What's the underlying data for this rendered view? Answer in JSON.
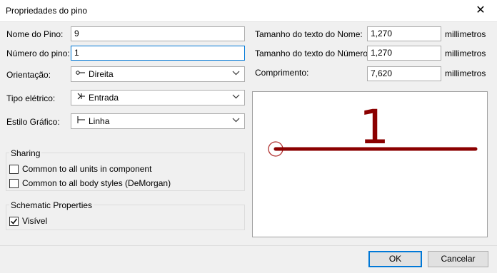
{
  "window": {
    "title": "Propriedades do pino",
    "close_glyph": "✕"
  },
  "left": {
    "pin_name": {
      "label": "Nome do Pino:",
      "value": "9"
    },
    "pin_number": {
      "label": "Número do pino:",
      "value": "1"
    },
    "orientation": {
      "label": "Orientação:",
      "value": "Direita",
      "icon": "pin-right-icon"
    },
    "electrical_type": {
      "label": "Tipo elétrico:",
      "value": "Entrada",
      "icon": "input-arrow-icon"
    },
    "graphic_style": {
      "label": "Estilo Gráfico:",
      "value": "Linha",
      "icon": "line-style-icon"
    }
  },
  "sharing": {
    "title": "Sharing",
    "units": {
      "label": "Common to all units in component",
      "checked": false
    },
    "body_styles": {
      "label": "Common to all body styles (DeMorgan)",
      "checked": false
    }
  },
  "schematic": {
    "title": "Schematic Properties",
    "visible": {
      "label": "Visível",
      "checked": true
    }
  },
  "right": {
    "name_text_size": {
      "label": "Tamanho do texto do Nome:",
      "value": "1,270",
      "unit": "millimetros"
    },
    "number_text_size": {
      "label": "Tamanho do texto do Número:",
      "value": "1,270",
      "unit": "millimetros"
    },
    "length": {
      "label": "Comprimento:",
      "value": "7,620",
      "unit": "millimetros"
    }
  },
  "preview": {
    "pin_number": "1",
    "pin_color": "#8b0000",
    "circle_color": "#b0302f"
  },
  "buttons": {
    "ok": "OK",
    "cancel": "Cancelar"
  }
}
